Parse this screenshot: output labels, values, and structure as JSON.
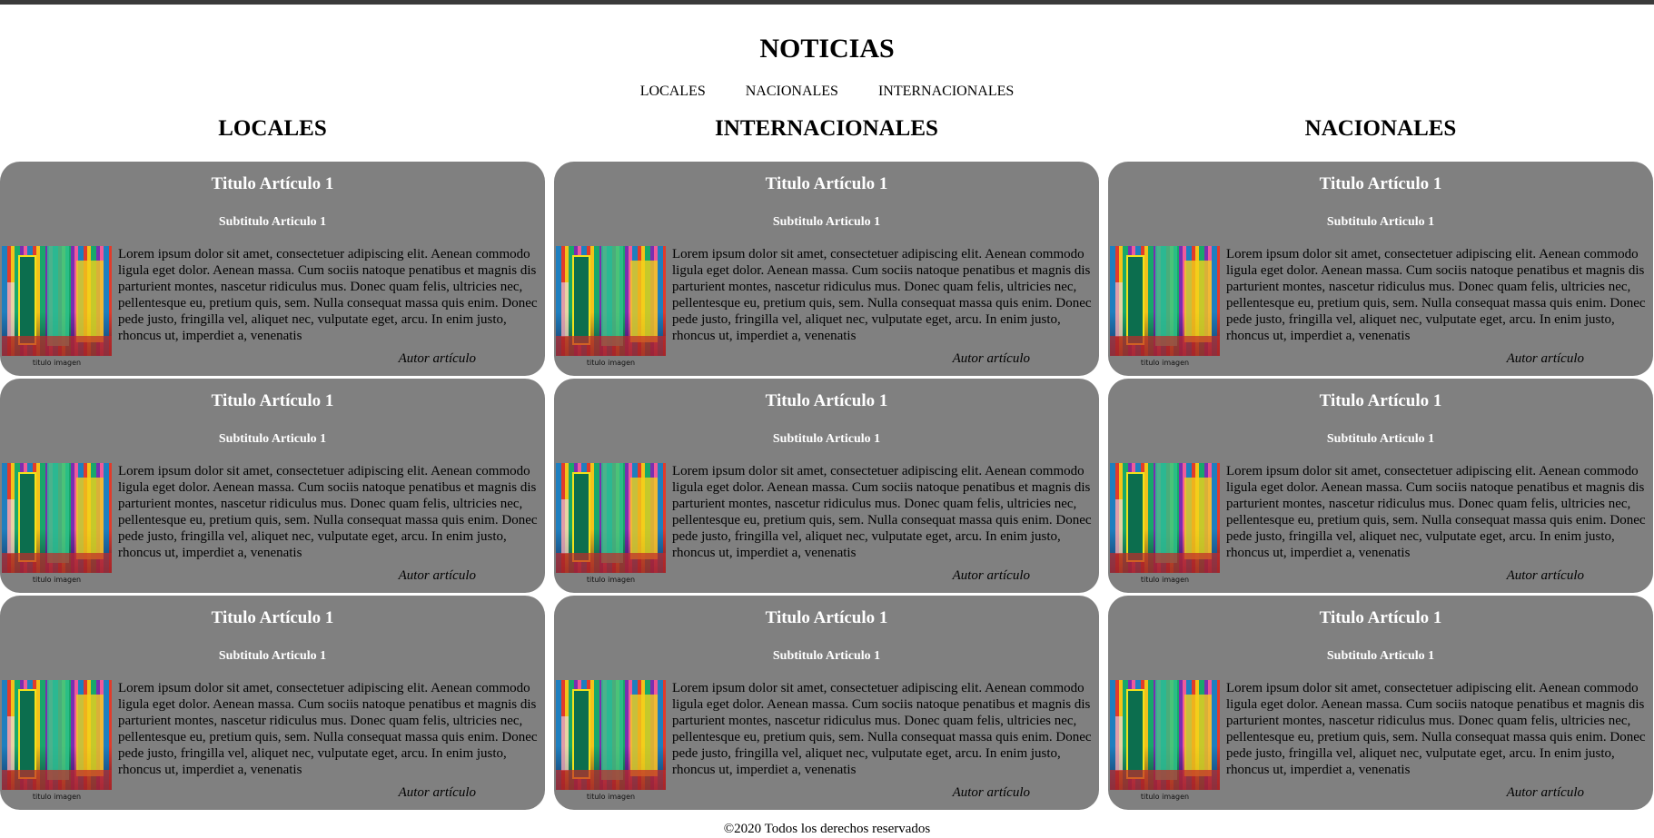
{
  "header": {
    "title": "NOTICIAS",
    "nav": [
      "LOCALES",
      "NACIONALES",
      "INTERNACIONALES"
    ]
  },
  "columns": [
    {
      "heading": "LOCALES",
      "articles": [
        {
          "title": "Titulo Artículo 1",
          "subtitle": "Subtitulo Articulo 1",
          "body": "Lorem ipsum dolor sit amet, consectetuer adipiscing elit. Aenean commodo ligula eget dolor. Aenean massa. Cum sociis natoque penatibus et magnis dis parturient montes, nascetur ridiculus mus. Donec quam felis, ultricies nec, pellentesque eu, pretium quis, sem. Nulla consequat massa quis enim. Donec pede justo, fringilla vel, aliquet nec, vulputate eget, arcu. In enim justo, rhoncus ut, imperdiet a, venenatis",
          "caption": "titulo imagen",
          "author": "Autor artículo"
        },
        {
          "title": "Titulo Artículo 1",
          "subtitle": "Subtitulo Articulo 1",
          "body": "Lorem ipsum dolor sit amet, consectetuer adipiscing elit. Aenean commodo ligula eget dolor. Aenean massa. Cum sociis natoque penatibus et magnis dis parturient montes, nascetur ridiculus mus. Donec quam felis, ultricies nec, pellentesque eu, pretium quis, sem. Nulla consequat massa quis enim. Donec pede justo, fringilla vel, aliquet nec, vulputate eget, arcu. In enim justo, rhoncus ut, imperdiet a, venenatis",
          "caption": "titulo imagen",
          "author": "Autor artículo"
        },
        {
          "title": "Titulo Artículo 1",
          "subtitle": "Subtitulo Articulo 1",
          "body": "Lorem ipsum dolor sit amet, consectetuer adipiscing elit. Aenean commodo ligula eget dolor. Aenean massa. Cum sociis natoque penatibus et magnis dis parturient montes, nascetur ridiculus mus. Donec quam felis, ultricies nec, pellentesque eu, pretium quis, sem. Nulla consequat massa quis enim. Donec pede justo, fringilla vel, aliquet nec, vulputate eget, arcu. In enim justo, rhoncus ut, imperdiet a, venenatis",
          "caption": "titulo imagen",
          "author": "Autor artículo"
        }
      ]
    },
    {
      "heading": "INTERNACIONALES",
      "articles": [
        {
          "title": "Titulo Artículo 1",
          "subtitle": "Subtitulo Articulo 1",
          "body": "Lorem ipsum dolor sit amet, consectetuer adipiscing elit. Aenean commodo ligula eget dolor. Aenean massa. Cum sociis natoque penatibus et magnis dis parturient montes, nascetur ridiculus mus. Donec quam felis, ultricies nec, pellentesque eu, pretium quis, sem. Nulla consequat massa quis enim. Donec pede justo, fringilla vel, aliquet nec, vulputate eget, arcu. In enim justo, rhoncus ut, imperdiet a, venenatis",
          "caption": "titulo imagen",
          "author": "Autor artículo"
        },
        {
          "title": "Titulo Artículo 1",
          "subtitle": "Subtitulo Articulo 1",
          "body": "Lorem ipsum dolor sit amet, consectetuer adipiscing elit. Aenean commodo ligula eget dolor. Aenean massa. Cum sociis natoque penatibus et magnis dis parturient montes, nascetur ridiculus mus. Donec quam felis, ultricies nec, pellentesque eu, pretium quis, sem. Nulla consequat massa quis enim. Donec pede justo, fringilla vel, aliquet nec, vulputate eget, arcu. In enim justo, rhoncus ut, imperdiet a, venenatis",
          "caption": "titulo imagen",
          "author": "Autor artículo"
        },
        {
          "title": "Titulo Artículo 1",
          "subtitle": "Subtitulo Articulo 1",
          "body": "Lorem ipsum dolor sit amet, consectetuer adipiscing elit. Aenean commodo ligula eget dolor. Aenean massa. Cum sociis natoque penatibus et magnis dis parturient montes, nascetur ridiculus mus. Donec quam felis, ultricies nec, pellentesque eu, pretium quis, sem. Nulla consequat massa quis enim. Donec pede justo, fringilla vel, aliquet nec, vulputate eget, arcu. In enim justo, rhoncus ut, imperdiet a, venenatis",
          "caption": "titulo imagen",
          "author": "Autor artículo"
        }
      ]
    },
    {
      "heading": "NACIONALES",
      "articles": [
        {
          "title": "Titulo Artículo 1",
          "subtitle": "Subtitulo Articulo 1",
          "body": "Lorem ipsum dolor sit amet, consectetuer adipiscing elit. Aenean commodo ligula eget dolor. Aenean massa. Cum sociis natoque penatibus et magnis dis parturient montes, nascetur ridiculus mus. Donec quam felis, ultricies nec, pellentesque eu, pretium quis, sem. Nulla consequat massa quis enim. Donec pede justo, fringilla vel, aliquet nec, vulputate eget, arcu. In enim justo, rhoncus ut, imperdiet a, venenatis",
          "caption": "titulo imagen",
          "author": "Autor artículo"
        },
        {
          "title": "Titulo Artículo 1",
          "subtitle": "Subtitulo Articulo 1",
          "body": "Lorem ipsum dolor sit amet, consectetuer adipiscing elit. Aenean commodo ligula eget dolor. Aenean massa. Cum sociis natoque penatibus et magnis dis parturient montes, nascetur ridiculus mus. Donec quam felis, ultricies nec, pellentesque eu, pretium quis, sem. Nulla consequat massa quis enim. Donec pede justo, fringilla vel, aliquet nec, vulputate eget, arcu. In enim justo, rhoncus ut, imperdiet a, venenatis",
          "caption": "titulo imagen",
          "author": "Autor artículo"
        },
        {
          "title": "Titulo Artículo 1",
          "subtitle": "Subtitulo Articulo 1",
          "body": "Lorem ipsum dolor sit amet, consectetuer adipiscing elit. Aenean commodo ligula eget dolor. Aenean massa. Cum sociis natoque penatibus et magnis dis parturient montes, nascetur ridiculus mus. Donec quam felis, ultricies nec, pellentesque eu, pretium quis, sem. Nulla consequat massa quis enim. Donec pede justo, fringilla vel, aliquet nec, vulputate eget, arcu. In enim justo, rhoncus ut, imperdiet a, venenatis",
          "caption": "titulo imagen",
          "author": "Autor artículo"
        }
      ]
    }
  ],
  "footer": {
    "text": "©2020 Todos los derechos reservados"
  }
}
